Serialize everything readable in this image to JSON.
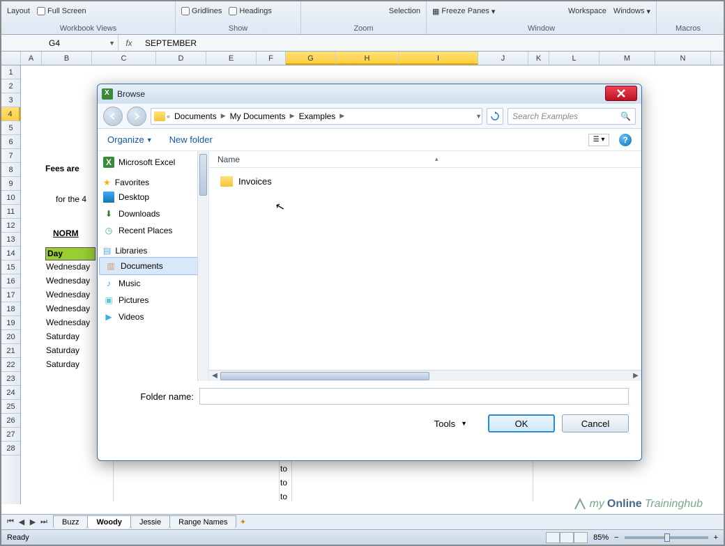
{
  "ribbon": {
    "layout_label": "Layout",
    "full_screen": "Full Screen",
    "gridlines": "Gridlines",
    "headings": "Headings",
    "selection": "Selection",
    "freeze_panes": "Freeze Panes",
    "workspace": "Workspace",
    "windows": "Windows",
    "groups": {
      "workbook_views": "Workbook Views",
      "show": "Show",
      "zoom": "Zoom",
      "window": "Window",
      "macros": "Macros"
    }
  },
  "formula_bar": {
    "name_box": "G4",
    "fx": "fx",
    "formula": "SEPTEMBER"
  },
  "columns": [
    "A",
    "B",
    "C",
    "D",
    "E",
    "F",
    "G",
    "H",
    "I",
    "J",
    "K",
    "L",
    "M",
    "N"
  ],
  "selected_cols": [
    "G",
    "H",
    "I"
  ],
  "rows": [
    1,
    2,
    3,
    4,
    5,
    6,
    7,
    8,
    9,
    10,
    11,
    12,
    13,
    14,
    15,
    16,
    17,
    18,
    19,
    20,
    21,
    22,
    23,
    24,
    25,
    26,
    27,
    28
  ],
  "selected_row": 4,
  "sheet_cells": {
    "fees_text": "Fees are",
    "for_the_text": "for the 4",
    "normal_text": "NORM",
    "day_header": "Day",
    "day_values": [
      "Wednesday",
      "Wednesday",
      "Wednesday",
      "Wednesday",
      "Wednesday",
      "Saturday",
      "Saturday",
      "Saturday"
    ],
    "to_values": [
      "to",
      "to",
      "to"
    ]
  },
  "sheet_tabs": {
    "items": [
      "Buzz",
      "Woody",
      "Jessie",
      "Range Names"
    ],
    "active": "Woody"
  },
  "status": {
    "ready": "Ready",
    "zoom": "85%"
  },
  "watermark": {
    "pre": "my",
    "mid": "Online",
    "post": "Traininghub"
  },
  "dialog": {
    "title": "Browse",
    "breadcrumb": [
      "Documents",
      "My Documents",
      "Examples"
    ],
    "breadcrumb_prefix": "«",
    "search_placeholder": "Search Examples",
    "organize": "Organize",
    "new_folder": "New folder",
    "name_col": "Name",
    "sidebar": {
      "excel": "Microsoft Excel",
      "favorites": "Favorites",
      "fav_items": [
        "Desktop",
        "Downloads",
        "Recent Places"
      ],
      "libraries": "Libraries",
      "lib_items": [
        "Documents",
        "Music",
        "Pictures",
        "Videos"
      ],
      "selected": "Documents"
    },
    "files": [
      "Invoices"
    ],
    "folder_label": "Folder name:",
    "folder_value": "",
    "tools": "Tools",
    "ok": "OK",
    "cancel": "Cancel",
    "help": "?"
  }
}
